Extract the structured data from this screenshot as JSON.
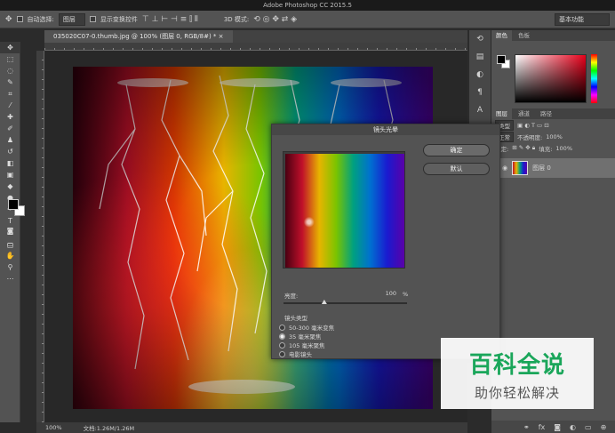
{
  "app": {
    "title": "Adobe Photoshop CC 2015.5"
  },
  "options": {
    "auto_select_label": "自动选择:",
    "auto_select_value": "图层",
    "show_transform_label": "显示变换控件",
    "mode_3d_label": "3D 模式:",
    "workspace": "基本功能"
  },
  "document": {
    "tab_title": "035020C07-0.thumb.jpg @ 100% (图层 0, RGB/8#) *",
    "zoom": "100%",
    "doc_size": "文档:1.26M/1.26M"
  },
  "colors_panel": {
    "tab_color": "颜色",
    "tab_swatches": "色板"
  },
  "layers_panel": {
    "tab_layers": "图层",
    "tab_channels": "通道",
    "tab_paths": "路径",
    "filter_kind": "类型",
    "blend_mode": "正常",
    "opacity_label": "不透明度:",
    "opacity_value": "100%",
    "lock_label": "锁定:",
    "fill_label": "填充:",
    "fill_value": "100%",
    "layer_name": "图层 0"
  },
  "dialog": {
    "title": "镜头光晕",
    "ok": "确定",
    "reset": "默认",
    "brightness_label": "亮度:",
    "brightness_value": "100",
    "brightness_unit": "%",
    "brightness_fraction": 0.33,
    "lens_type_label": "镜头类型",
    "lens_options": [
      "50-300 毫米变焦",
      "35 毫米聚焦",
      "105 毫米聚焦",
      "电影镜头"
    ],
    "selected_lens": "35 毫米聚焦"
  },
  "watermark": {
    "title": "百科全说",
    "subtitle": "助你轻松解决"
  }
}
